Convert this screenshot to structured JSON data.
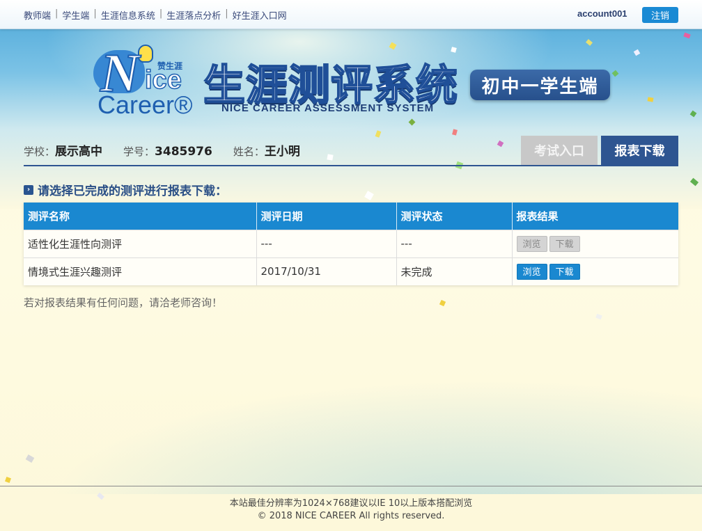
{
  "topnav": {
    "links": [
      "教师端",
      "学生端",
      "生涯信息系统",
      "生涯落点分析",
      "好生涯入口网"
    ],
    "separator": "|",
    "account": "account001",
    "logout_label": "注销"
  },
  "header": {
    "logo_brand_cn": "赞生涯",
    "logo_line1_N": "N",
    "logo_line1_rest": "ice",
    "logo_line2": "Career®",
    "title_cn": "生涯测评系统",
    "title_en": "NICE CAREER ASSESSMENT SYSTEM",
    "badge": "初中一学生端"
  },
  "student": {
    "school_label": "学校：",
    "school": "展示高中",
    "id_label": "学号：",
    "id": "3485976",
    "name_label": "姓名：",
    "name": "王小明"
  },
  "actions": {
    "exam_label": "考试入口",
    "report_label": "报表下载"
  },
  "section_title": "请选择已完成的测评进行报表下载：",
  "table": {
    "headers": [
      "测评名称",
      "测评日期",
      "测评状态",
      "报表结果"
    ],
    "rows": [
      {
        "name": "适性化生涯性向测评",
        "date": "---",
        "status": "---",
        "view": "浏览",
        "download": "下载",
        "enabled": false
      },
      {
        "name": "情境式生涯兴趣测评",
        "date": "2017/10/31",
        "status": "未完成",
        "view": "浏览",
        "download": "下载",
        "enabled": true
      }
    ]
  },
  "note": "若对报表结果有任何问题，请洽老师咨询！",
  "footer": {
    "line1": "本站最佳分辨率为1024×768建议以IE 10以上版本搭配浏览",
    "line2": "© 2018 NICE CAREER All rights reserved."
  },
  "colors": {
    "accent_blue": "#1a88d0",
    "dark_blue": "#2e5591",
    "disabled_gray": "#c8c8c8"
  }
}
